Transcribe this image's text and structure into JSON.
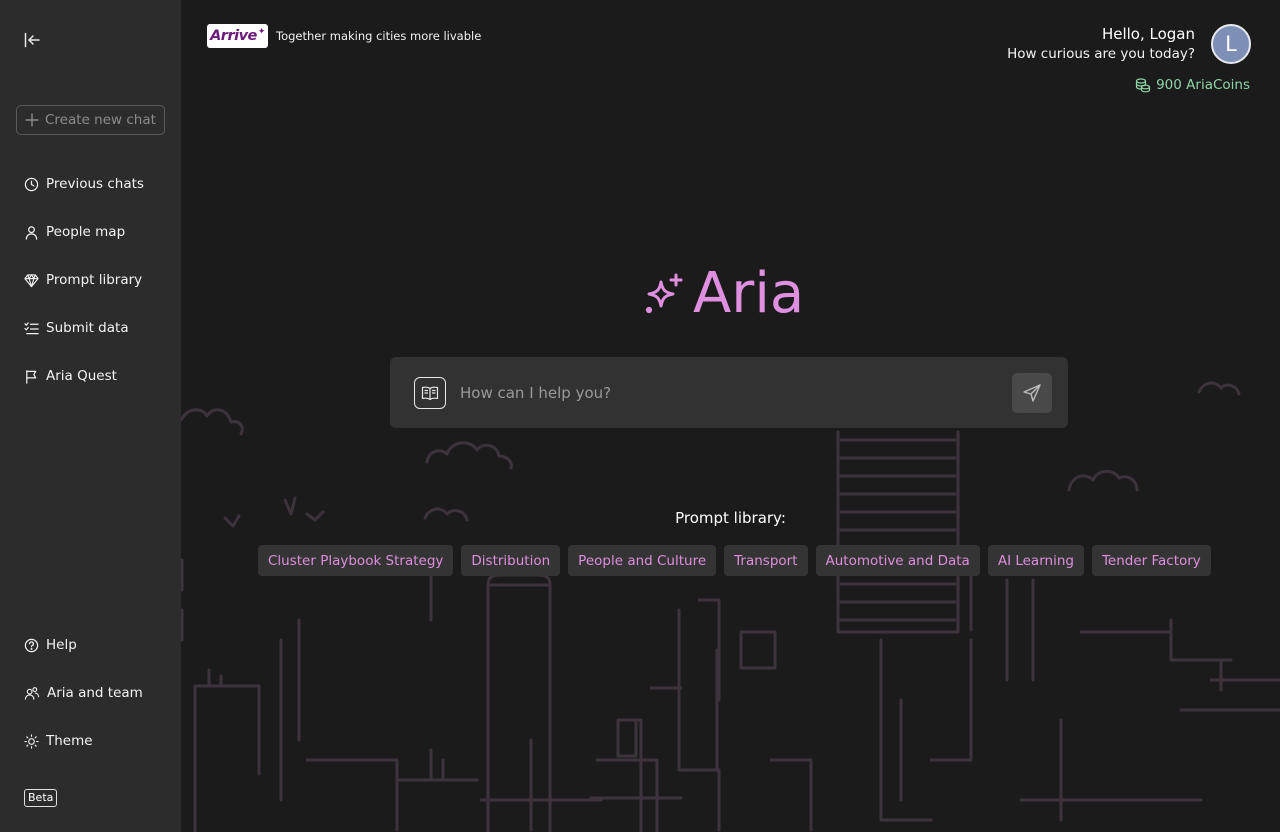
{
  "sidebar": {
    "new_chat_label": "Create new chat",
    "nav": [
      {
        "label": "Previous chats",
        "icon": "clock-icon"
      },
      {
        "label": "People map",
        "icon": "person-icon"
      },
      {
        "label": "Prompt library",
        "icon": "diamond-icon"
      },
      {
        "label": "Submit data",
        "icon": "checklist-icon"
      },
      {
        "label": "Aria Quest",
        "icon": "flag-icon"
      }
    ],
    "bottom": [
      {
        "label": "Help",
        "icon": "help-icon"
      },
      {
        "label": "Aria and team",
        "icon": "team-icon"
      },
      {
        "label": "Theme",
        "icon": "sun-icon"
      }
    ],
    "beta_label": "Beta"
  },
  "header": {
    "logo_text": "Arrive",
    "tagline": "Together making cities more livable",
    "greeting": "Hello, Logan",
    "subgreeting": "How curious are you today?",
    "avatar_initial": "L",
    "coins": "900 AriaCoins"
  },
  "brand": {
    "name": "Aria"
  },
  "chat": {
    "placeholder": "How can I help you?"
  },
  "prompt_library": {
    "title": "Prompt library:",
    "chips": [
      "Cluster Playbook Strategy",
      "Distribution",
      "People and Culture",
      "Transport",
      "Automotive and Data",
      "AI Learning",
      "Tender Factory"
    ]
  },
  "colors": {
    "accent": "#df8fe0",
    "coins": "#8fd4a6",
    "sidebar": "#2d2c2d",
    "background": "#1c1b1c"
  }
}
